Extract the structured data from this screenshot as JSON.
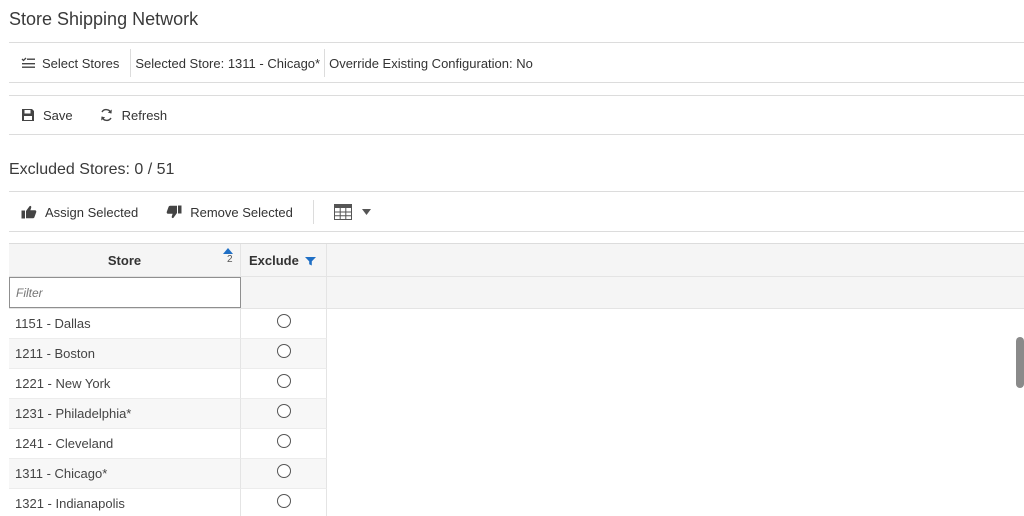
{
  "page": {
    "title": "Store Shipping Network"
  },
  "context": {
    "select_stores_label": "Select Stores",
    "selected_store_text": "Selected Store: 1311 - Chicago*",
    "override_text": "Override Existing Configuration: No"
  },
  "toolbar": {
    "save_label": "Save",
    "refresh_label": "Refresh"
  },
  "section": {
    "title": "Excluded Stores: 0 / 51"
  },
  "table_toolbar": {
    "assign_label": "Assign Selected",
    "remove_label": "Remove Selected"
  },
  "grid": {
    "columns": {
      "store": "Store",
      "exclude": "Exclude"
    },
    "sort_order": "2",
    "filter_placeholder": "Filter",
    "rows": [
      {
        "store": "1151 - Dallas",
        "excluded": false
      },
      {
        "store": "1211 - Boston",
        "excluded": false
      },
      {
        "store": "1221 - New York",
        "excluded": false
      },
      {
        "store": "1231 - Philadelphia*",
        "excluded": false
      },
      {
        "store": "1241 - Cleveland",
        "excluded": false
      },
      {
        "store": "1311 - Chicago*",
        "excluded": false
      },
      {
        "store": "1321 - Indianapolis",
        "excluded": false
      }
    ]
  },
  "colors": {
    "accent": "#1f6fc5",
    "border": "#dcdcdc",
    "header_bg": "#f5f5f5"
  },
  "icons": {
    "select_stores": "list-check-icon",
    "save": "save-icon",
    "refresh": "refresh-icon",
    "assign": "thumbs-up-icon",
    "remove": "thumbs-down-icon",
    "columns": "table-icon",
    "dropdown": "caret-down-icon",
    "sort_asc": "sort-ascending-icon",
    "filter": "filter-icon"
  }
}
